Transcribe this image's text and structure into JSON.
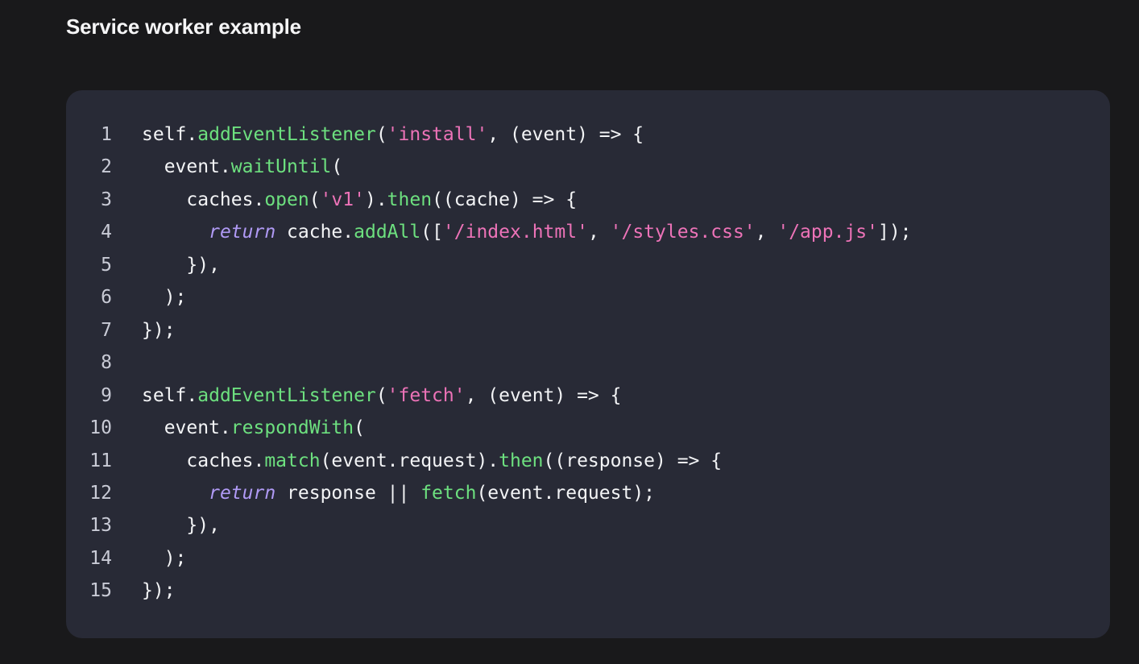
{
  "section": {
    "title": "Service worker example"
  },
  "code": {
    "lines": [
      {
        "number": "1",
        "tokens": [
          {
            "type": "plain",
            "text": "self."
          },
          {
            "type": "fn",
            "text": "addEventListener"
          },
          {
            "type": "plain",
            "text": "("
          },
          {
            "type": "str",
            "text": "'install'"
          },
          {
            "type": "plain",
            "text": ", (event) => {"
          }
        ]
      },
      {
        "number": "2",
        "tokens": [
          {
            "type": "plain",
            "text": "  event."
          },
          {
            "type": "fn",
            "text": "waitUntil"
          },
          {
            "type": "plain",
            "text": "("
          }
        ]
      },
      {
        "number": "3",
        "tokens": [
          {
            "type": "plain",
            "text": "    caches."
          },
          {
            "type": "fn",
            "text": "open"
          },
          {
            "type": "plain",
            "text": "("
          },
          {
            "type": "str",
            "text": "'v1'"
          },
          {
            "type": "plain",
            "text": ")."
          },
          {
            "type": "fn",
            "text": "then"
          },
          {
            "type": "plain",
            "text": "((cache) => {"
          }
        ]
      },
      {
        "number": "4",
        "tokens": [
          {
            "type": "plain",
            "text": "      "
          },
          {
            "type": "kw",
            "text": "return"
          },
          {
            "type": "plain",
            "text": " cache."
          },
          {
            "type": "fn",
            "text": "addAll"
          },
          {
            "type": "plain",
            "text": "(["
          },
          {
            "type": "str",
            "text": "'/index.html'"
          },
          {
            "type": "plain",
            "text": ", "
          },
          {
            "type": "str",
            "text": "'/styles.css'"
          },
          {
            "type": "plain",
            "text": ", "
          },
          {
            "type": "str",
            "text": "'/app.js'"
          },
          {
            "type": "plain",
            "text": "]);"
          }
        ]
      },
      {
        "number": "5",
        "tokens": [
          {
            "type": "plain",
            "text": "    }),"
          }
        ]
      },
      {
        "number": "6",
        "tokens": [
          {
            "type": "plain",
            "text": "  );"
          }
        ]
      },
      {
        "number": "7",
        "tokens": [
          {
            "type": "plain",
            "text": "});"
          }
        ]
      },
      {
        "number": "8",
        "tokens": []
      },
      {
        "number": "9",
        "tokens": [
          {
            "type": "plain",
            "text": "self."
          },
          {
            "type": "fn",
            "text": "addEventListener"
          },
          {
            "type": "plain",
            "text": "("
          },
          {
            "type": "str",
            "text": "'fetch'"
          },
          {
            "type": "plain",
            "text": ", (event) => {"
          }
        ]
      },
      {
        "number": "10",
        "tokens": [
          {
            "type": "plain",
            "text": "  event."
          },
          {
            "type": "fn",
            "text": "respondWith"
          },
          {
            "type": "plain",
            "text": "("
          }
        ]
      },
      {
        "number": "11",
        "tokens": [
          {
            "type": "plain",
            "text": "    caches."
          },
          {
            "type": "fn",
            "text": "match"
          },
          {
            "type": "plain",
            "text": "(event.request)."
          },
          {
            "type": "fn",
            "text": "then"
          },
          {
            "type": "plain",
            "text": "((response) => {"
          }
        ]
      },
      {
        "number": "12",
        "tokens": [
          {
            "type": "plain",
            "text": "      "
          },
          {
            "type": "kw",
            "text": "return"
          },
          {
            "type": "plain",
            "text": " response || "
          },
          {
            "type": "fn",
            "text": "fetch"
          },
          {
            "type": "plain",
            "text": "(event.request);"
          }
        ]
      },
      {
        "number": "13",
        "tokens": [
          {
            "type": "plain",
            "text": "    }),"
          }
        ]
      },
      {
        "number": "14",
        "tokens": [
          {
            "type": "plain",
            "text": "  );"
          }
        ]
      },
      {
        "number": "15",
        "tokens": [
          {
            "type": "plain",
            "text": "});"
          }
        ]
      }
    ]
  }
}
